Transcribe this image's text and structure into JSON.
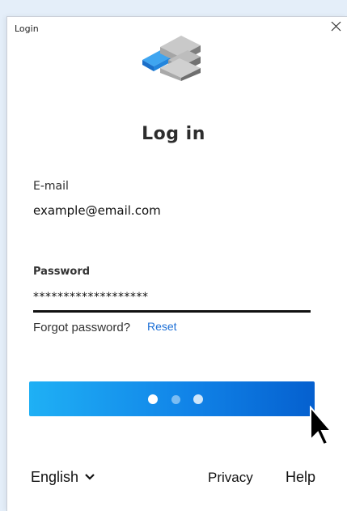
{
  "window": {
    "title": "Login"
  },
  "login": {
    "heading": "Log in",
    "email_label": "E-mail",
    "email_value": "example@email.com",
    "password_label": "Password",
    "password_value": "*******************",
    "forgot_text": "Forgot password?",
    "reset_link": "Reset",
    "login_button_state": "loading"
  },
  "footer": {
    "language": "English",
    "privacy": "Privacy",
    "help": "Help"
  },
  "colors": {
    "accent": "#1c6fd6",
    "button_gradient_start": "#1fb0f5",
    "button_gradient_end": "#0560cf",
    "background": "#e4eef9"
  },
  "icons": {
    "logo": "stacked-blocks-logo-icon",
    "close": "close-icon",
    "language_dropdown": "chevron-down-icon",
    "pointer": "mouse-pointer-icon"
  }
}
